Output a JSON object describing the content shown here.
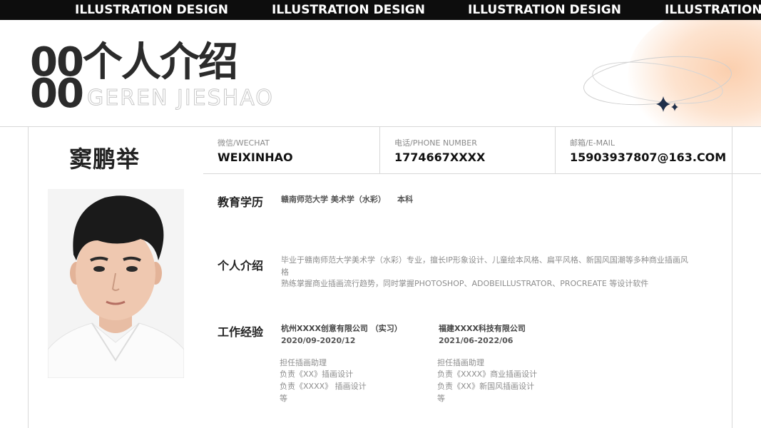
{
  "banner": {
    "items": [
      "ILLUSTRATION DESIGN",
      "ILLUSTRATION DESIGN",
      "ILLUSTRATION DESIGN",
      "ILLUSTRATION DESIGN"
    ]
  },
  "header": {
    "number": "00",
    "title": "00个人介绍",
    "subtitle": "GEREN JIESHAO"
  },
  "profile": {
    "name": "窦鹏举"
  },
  "contacts": [
    {
      "label": "微信/WECHAT",
      "value": "WEIXINHAO"
    },
    {
      "label": "电话/PHONE NUMBER",
      "value": "1774667XXXX"
    },
    {
      "label": "邮箱/E-MAIL",
      "value": "15903937807@163.COM"
    }
  ],
  "education": {
    "title": "教育学历",
    "school": "赣南师范大学 美术学（水彩）",
    "degree": "本科"
  },
  "intro": {
    "title": "个人介绍",
    "lines": [
      "毕业于赣南师范大学美术学（水彩）专业，擅长IP形象设计、儿童绘本风格、扁平风格、新国风国潮等多种商业插画风",
      "格",
      "熟练掌握商业插画流行趋势，同时掌握PHOTOSHOP、ADOBEILLUSTRATOR、PROCREATE 等设计软件"
    ]
  },
  "experience": {
    "title": "工作经验",
    "jobs": [
      {
        "company": "杭州XXXX创意有限公司 （实习）",
        "period": "2020/09-2020/12",
        "duties": [
          "担任插画助理",
          "负责《XX》插画设计",
          "负责《XXXX》 插画设计",
          "等"
        ]
      },
      {
        "company": "福建XXXX科技有限公司",
        "period": "2021/06-2022/06",
        "duties": [
          "担任插画助理",
          "负责《XXXX》商业插画设计",
          "负责《XX》新国风插画设计",
          "等"
        ]
      }
    ]
  },
  "colors": {
    "banner": "#0d0d0d",
    "accent_glow": "#fbcfae",
    "star": "#1f2f4a"
  }
}
